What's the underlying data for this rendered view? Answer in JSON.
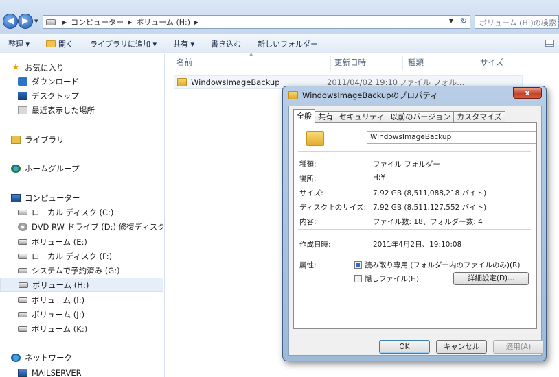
{
  "address": {
    "path": [
      "コンピューター",
      "ボリューム (H:)"
    ],
    "search_placeholder": "ボリューム (H:)の検索"
  },
  "toolbar": {
    "organize": "整理 ▾",
    "open": "開く",
    "include_library": "ライブラリに追加 ▾",
    "share": "共有 ▾",
    "burn": "書き込む",
    "new_folder": "新しいフォルダー"
  },
  "sidebar": {
    "favorites": "お気に入り",
    "downloads": "ダウンロード",
    "desktop": "デスクトップ",
    "recent": "最近表示した場所",
    "libraries": "ライブラリ",
    "homegroup": "ホームグループ",
    "computer": "コンピューター",
    "drives": [
      {
        "label": "ローカル ディスク (C:)",
        "icon": "drive-icon"
      },
      {
        "label": "DVD RW ドライブ (D:) 修復ディスク W",
        "icon": "dvd-icon"
      },
      {
        "label": "ボリューム (E:)",
        "icon": "drive-icon"
      },
      {
        "label": "ローカル ディスク (F:)",
        "icon": "drive-icon"
      },
      {
        "label": "システムで予約済み (G:)",
        "icon": "drive-icon"
      },
      {
        "label": "ボリューム (H:)",
        "icon": "drive-icon",
        "selected": true
      },
      {
        "label": "ボリューム (I:)",
        "icon": "drive-icon"
      },
      {
        "label": "ボリューム (J:)",
        "icon": "drive-icon"
      },
      {
        "label": "ボリューム (K:)",
        "icon": "drive-icon"
      }
    ],
    "network": "ネットワーク",
    "mailserver": "MAILSERVER"
  },
  "filelist": {
    "columns": [
      "名前",
      "更新日時",
      "種類",
      "サイズ"
    ],
    "rows": [
      {
        "name": "WindowsImageBackup",
        "date": "2011/04/02 19:10",
        "type": "ファイル フォル..."
      }
    ]
  },
  "dialog": {
    "title": "WindowsImageBackupのプロパティ",
    "close": "x",
    "tabs": [
      "全般",
      "共有",
      "セキュリティ",
      "以前のバージョン",
      "カスタマイズ"
    ],
    "name_value": "WindowsImageBackup",
    "props": {
      "type_label": "種類:",
      "type_value": "ファイル フォルダー",
      "location_label": "場所:",
      "location_value": "H:¥",
      "size_label": "サイズ:",
      "size_value": "7.92 GB (8,511,088,218 バイト)",
      "disk_size_label": "ディスク上のサイズ:",
      "disk_size_value": "7.92 GB (8,511,127,552 バイト)",
      "contents_label": "内容:",
      "contents_value": "ファイル数: 18、フォルダー数: 4",
      "created_label": "作成日時:",
      "created_value": "2011年4月2日、19:10:08",
      "attributes_label": "属性:",
      "readonly_label": "読み取り専用 (フォルダー内のファイルのみ)(R)",
      "hidden_label": "隠しファイル(H)",
      "advanced_label": "詳細設定(D)..."
    },
    "buttons": {
      "ok": "OK",
      "cancel": "キャンセル",
      "apply": "適用(A)"
    }
  }
}
